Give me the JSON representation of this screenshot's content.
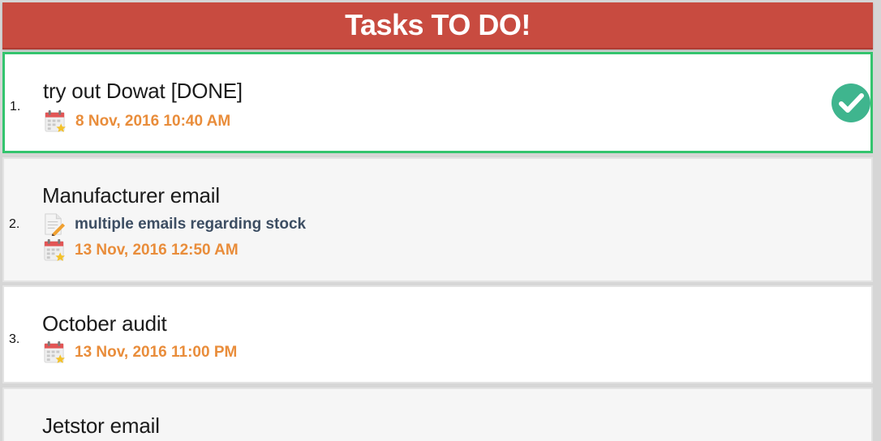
{
  "header": {
    "title": "Tasks TO DO!"
  },
  "colors": {
    "header_bg": "#c84b40",
    "selected_border": "#34c46e",
    "date_text": "#e98d3b",
    "note_text": "#3d4e63",
    "check": "#3fb58e"
  },
  "tasks": [
    {
      "number": "1.",
      "title": "try out Dowat [DONE]",
      "note": "",
      "date": "8 Nov, 2016 10:40 AM",
      "done": true,
      "selected": true
    },
    {
      "number": "2.",
      "title": "Manufacturer email",
      "note": "multiple emails regarding stock",
      "date": "13 Nov, 2016 12:50 AM",
      "done": false,
      "selected": false
    },
    {
      "number": "3.",
      "title": "October audit",
      "note": "",
      "date": "13 Nov, 2016 11:00 PM",
      "done": false,
      "selected": false
    },
    {
      "number": "",
      "title": "Jetstor email",
      "note": "",
      "date": "",
      "done": false,
      "selected": false
    }
  ]
}
